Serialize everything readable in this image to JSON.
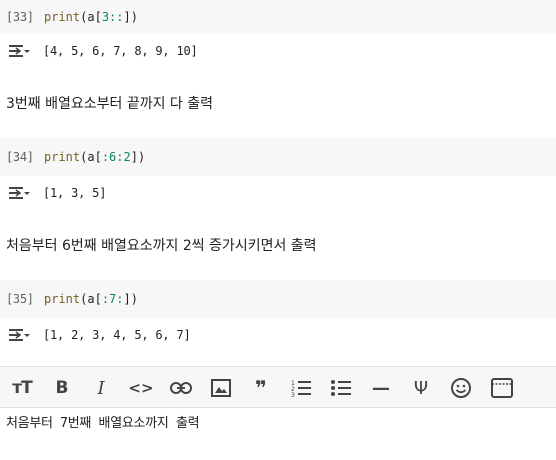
{
  "cells": [
    {
      "prompt": "[33]",
      "code": {
        "fn": "print",
        "open": "(",
        "arg": "a",
        "open2": "[",
        "slice": "3::",
        "close": "])"
      },
      "output": "[4, 5, 6, 7, 8, 9, 10]"
    },
    {
      "prompt": "[34]",
      "code": {
        "fn": "print",
        "open": "(",
        "arg": "a",
        "open2": "[",
        "slice": ":6:2",
        "close": "])"
      },
      "output": "[1, 3, 5]"
    },
    {
      "prompt": "[35]",
      "code": {
        "fn": "print",
        "open": "(",
        "arg": "a",
        "open2": "[",
        "slice": ":7:",
        "close": "])"
      },
      "output": "[1, 2, 3, 4, 5, 6, 7]"
    }
  ],
  "markdown": [
    "3번째 배열요소부터 끝까지 다 출력",
    "처음부터 6번째 배열요소까지 2씩 증가시키면서 출력"
  ],
  "toolbar": {
    "heading": "тT",
    "bold": "B",
    "italic": "I",
    "code": "<>",
    "quote": "❞",
    "hr": "—",
    "math": "Ψ"
  },
  "editor_text": "처음부터 7번째 배열요소까지 출력",
  "icons": {
    "output": "output-toggle-icon",
    "heading": "text-size-icon",
    "bold": "bold-icon",
    "italic": "italic-icon",
    "code": "code-icon",
    "link": "link-icon",
    "image": "image-icon",
    "quote": "quote-icon",
    "numbered_list": "numbered-list-icon",
    "bullet_list": "bullet-list-icon",
    "hr": "horizontal-rule-icon",
    "math": "latex-icon",
    "emoji": "emoji-icon",
    "preview": "preview-icon"
  }
}
